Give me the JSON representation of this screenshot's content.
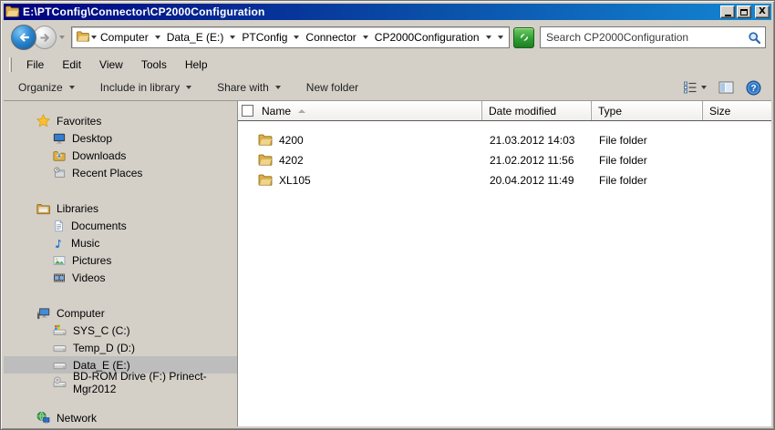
{
  "window": {
    "title": "E:\\PTConfig\\Connector\\CP2000Configuration"
  },
  "nav": {
    "breadcrumb": [
      {
        "label": "Computer"
      },
      {
        "label": "Data_E (E:)"
      },
      {
        "label": "PTConfig"
      },
      {
        "label": "Connector"
      },
      {
        "label": "CP2000Configuration"
      }
    ],
    "search": {
      "placeholder": "Search CP2000Configuration",
      "value": ""
    }
  },
  "menubar": {
    "items": [
      {
        "label": "File"
      },
      {
        "label": "Edit"
      },
      {
        "label": "View"
      },
      {
        "label": "Tools"
      },
      {
        "label": "Help"
      }
    ]
  },
  "toolbar": {
    "items": [
      {
        "label": "Organize",
        "dropdown": true
      },
      {
        "label": "Include in library",
        "dropdown": true
      },
      {
        "label": "Share with",
        "dropdown": true
      },
      {
        "label": "New folder",
        "dropdown": false
      }
    ]
  },
  "list": {
    "columns": [
      {
        "label": "Name",
        "sorted": "ascending"
      },
      {
        "label": "Date modified"
      },
      {
        "label": "Type"
      },
      {
        "label": "Size"
      }
    ],
    "rows": [
      {
        "name": "4200",
        "date_modified": "21.03.2012 14:03",
        "type": "File folder",
        "size": ""
      },
      {
        "name": "4202",
        "date_modified": "21.02.2012 11:56",
        "type": "File folder",
        "size": ""
      },
      {
        "name": "XL105",
        "date_modified": "20.04.2012 11:49",
        "type": "File folder",
        "size": ""
      }
    ]
  },
  "sidebar": {
    "groups": [
      {
        "label": "Favorites",
        "items": [
          {
            "label": "Desktop"
          },
          {
            "label": "Downloads"
          },
          {
            "label": "Recent Places"
          }
        ]
      },
      {
        "label": "Libraries",
        "items": [
          {
            "label": "Documents"
          },
          {
            "label": "Music"
          },
          {
            "label": "Pictures"
          },
          {
            "label": "Videos"
          }
        ]
      },
      {
        "label": "Computer",
        "items": [
          {
            "label": "SYS_C (C:)"
          },
          {
            "label": "Temp_D (D:)"
          },
          {
            "label": "Data_E (E:)",
            "selected": true
          },
          {
            "label": "BD-ROM Drive (F:) Prinect-Mgr2012"
          }
        ]
      },
      {
        "label": "Network",
        "items": []
      }
    ]
  },
  "colors": {
    "titlebar_gradient_start": "#01017e",
    "titlebar_gradient_end": "#1487d2",
    "chrome_gray": "#d4d0c8",
    "selection_gray": "#bdbdbd",
    "refresh_green": "#2f9e33",
    "folder_gold": "#deae45"
  }
}
